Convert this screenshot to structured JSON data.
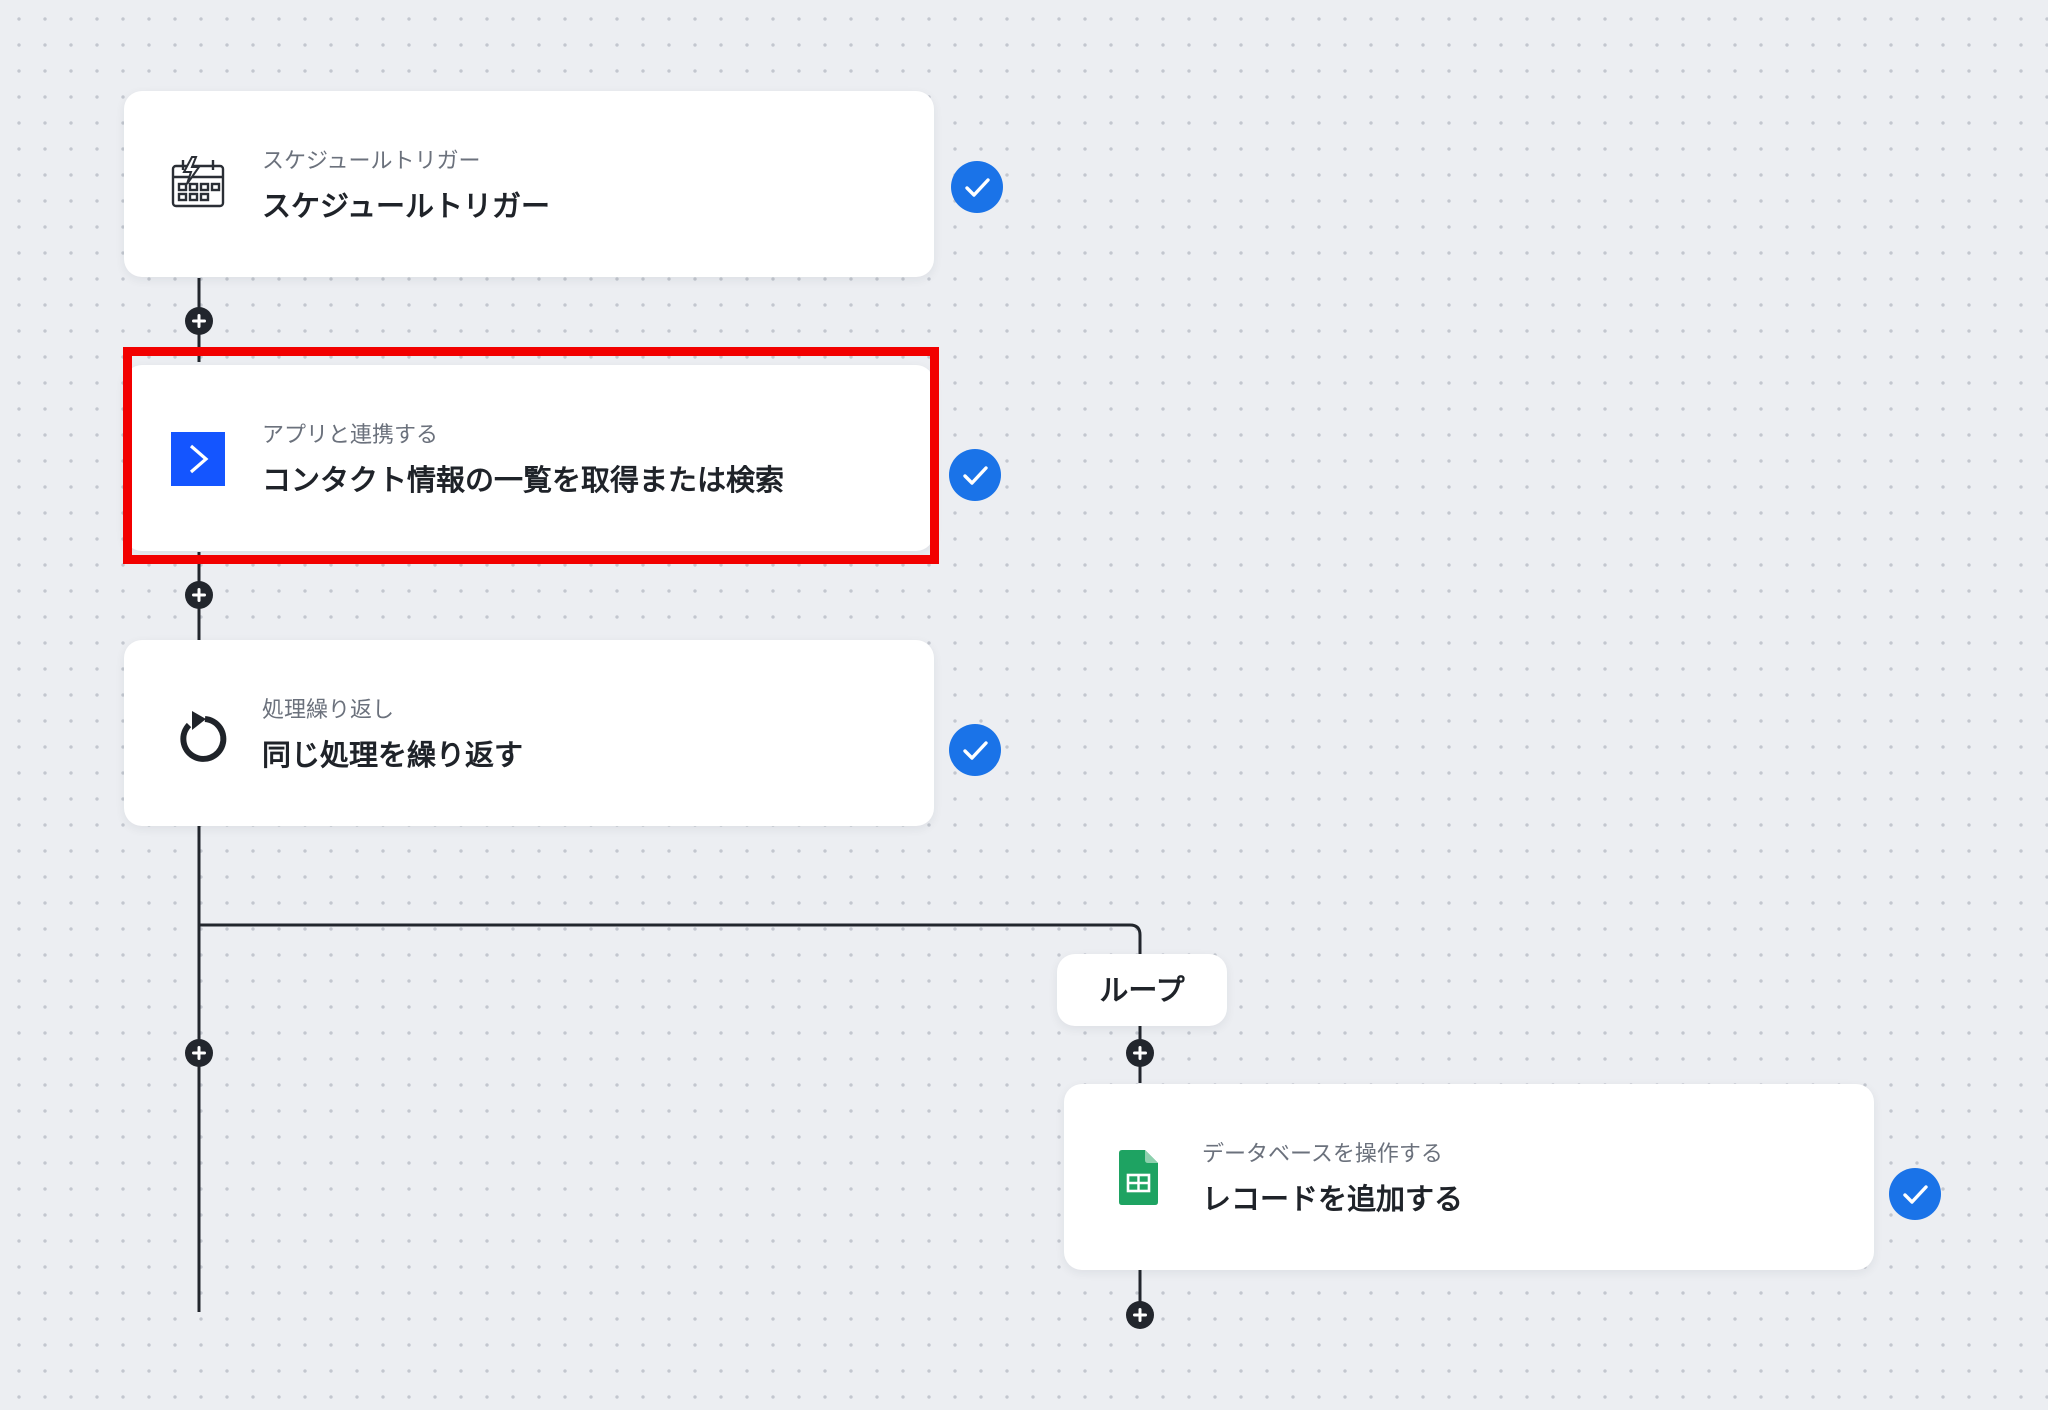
{
  "flow": {
    "steps": [
      {
        "subtitle": "スケジュールトリガー",
        "title": "スケジュールトリガー",
        "icon": "calendar-trigger-icon"
      },
      {
        "subtitle": "アプリと連携する",
        "title": "コンタクト情報の一覧を取得または検索",
        "icon": "activecampaign-app-icon"
      },
      {
        "subtitle": "処理繰り返し",
        "title": "同じ処理を繰り返す",
        "icon": "loop-arrow-icon"
      },
      {
        "subtitle": "データベースを操作する",
        "title": "レコードを追加する",
        "icon": "google-sheets-icon"
      }
    ],
    "loop_label": "ループ"
  },
  "colors": {
    "background": "#eceef2",
    "check_badge": "#1a73e8",
    "highlight": "#f20000",
    "app_icon": "#1455ff",
    "sheets_icon": "#1ea362"
  }
}
